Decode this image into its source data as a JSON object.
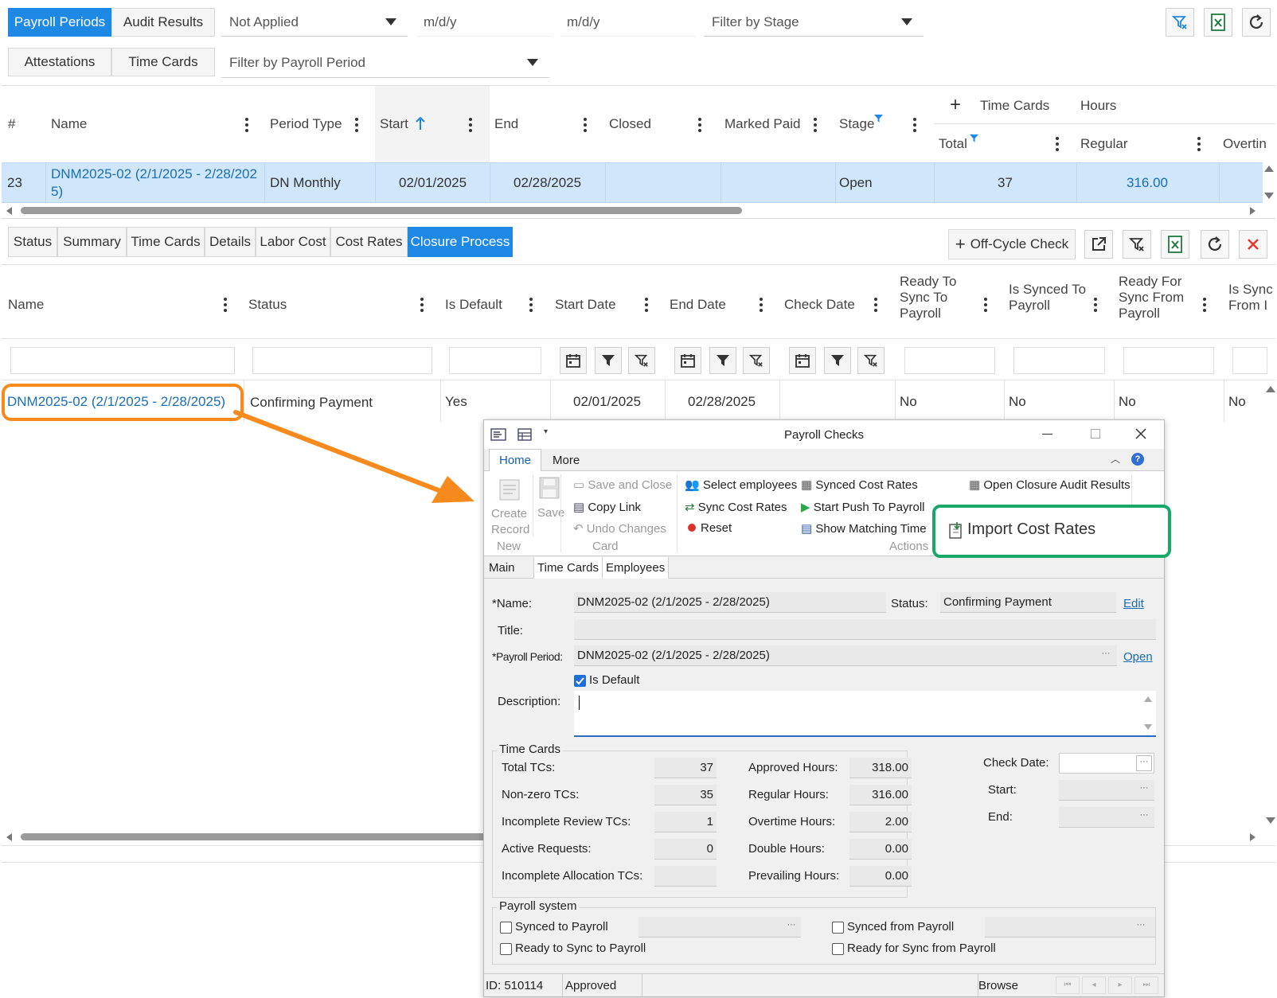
{
  "top_tabs": [
    "Payroll Periods",
    "Audit Results"
  ],
  "second_tabs": [
    "Attestations",
    "Time Cards"
  ],
  "filters": {
    "applied": "Not Applied",
    "date_from": "m/d/y",
    "date_to": "m/d/y",
    "stage_placeholder": "Filter by Stage",
    "period_placeholder": "Filter by Payroll Period"
  },
  "periods_grid": {
    "headers": {
      "num": "#",
      "name": "Name",
      "period_type": "Period Type",
      "start": "Start",
      "end": "End",
      "closed": "Closed",
      "marked_paid": "Marked Paid",
      "stage": "Stage",
      "time_cards": "Time Cards",
      "hours": "Hours",
      "total": "Total",
      "regular": "Regular",
      "overtime": "Overtin"
    },
    "row": {
      "num": "23",
      "name": "DNM2025-02 (2/1/2025 - 2/28/2025)",
      "name_l1": "DNM2025-02 (2/1/2025 - 2/28/202",
      "name_l2": "5)",
      "period_type": "DN Monthly",
      "start": "02/01/2025",
      "end": "02/28/2025",
      "closed": "",
      "marked_paid": "",
      "stage": "Open",
      "total": "37",
      "regular": "316.00"
    }
  },
  "detail_tabs": [
    "Status",
    "Summary",
    "Time Cards",
    "Details",
    "Labor Cost",
    "Cost Rates",
    "Closure Process"
  ],
  "off_cycle_label": "Off-Cycle Check",
  "closure_grid": {
    "headers": {
      "name": "Name",
      "status": "Status",
      "is_default": "Is Default",
      "start_date": "Start Date",
      "end_date": "End Date",
      "check_date": "Check Date",
      "ready_sync_to": [
        "Ready To",
        "Sync To",
        "Payroll"
      ],
      "is_synced_to": [
        "Is Synced To",
        "Payroll"
      ],
      "ready_sync_from": [
        "Ready For",
        "Sync From",
        "Payroll"
      ],
      "is_sync_from": [
        "Is Sync",
        "From I"
      ]
    },
    "row": {
      "name": "DNM2025-02 (2/1/2025 - 2/28/2025)",
      "status": "Confirming Payment",
      "is_default": "Yes",
      "start_date": "02/01/2025",
      "end_date": "02/28/2025",
      "check_date": "",
      "ready_sync_to": "No",
      "is_synced_to": "No",
      "ready_sync_from": "No",
      "is_sync_from": "No"
    }
  },
  "dialog": {
    "title": "Payroll Checks",
    "ribbon_tabs": [
      "Home",
      "More"
    ],
    "new_group": {
      "create": "Create",
      "record": "Record",
      "save": "Save",
      "label": "New"
    },
    "card_group": {
      "save_close": "Save and Close",
      "copy_link": "Copy Link",
      "undo": "Undo Changes",
      "label": "Card"
    },
    "actions": {
      "select_employees": "Select employees",
      "sync_cost_rates": "Sync Cost Rates",
      "reset": "Reset",
      "synced_cost_rates": "Synced Cost Rates",
      "start_push": "Start Push To Payroll",
      "show_matching": "Show Matching Time",
      "open_audit": "Open Closure Audit Results",
      "import_cost_rates": "Import Cost Rates",
      "label": "Actions"
    },
    "form_tabs": [
      "Main",
      "Time Cards",
      "Employees"
    ],
    "form": {
      "name_label": "*Name:",
      "name": "DNM2025-02 (2/1/2025 - 2/28/2025)",
      "status_label": "Status:",
      "status": "Confirming Payment",
      "edit": "Edit",
      "title_label": "Title:",
      "title": "",
      "period_label": "*Payroll Period:",
      "period": "DNM2025-02 (2/1/2025 - 2/28/2025)",
      "open": "Open",
      "is_default": "Is Default",
      "description_label": "Description:"
    },
    "time_cards": {
      "group": "Time Cards",
      "total_label": "Total TCs:",
      "total": "37",
      "nonzero_label": "Non-zero TCs:",
      "nonzero": "35",
      "incomplete_label": "Incomplete Review TCs:",
      "incomplete": "1",
      "active_label": "Active Requests:",
      "active": "0",
      "alloc_label": "Incomplete Allocation TCs:",
      "alloc": "",
      "approved_label": "Approved Hours:",
      "approved": "318.00",
      "regular_label": "Regular Hours:",
      "regular": "316.00",
      "overtime_label": "Overtime Hours:",
      "overtime": "2.00",
      "double_label": "Double Hours:",
      "double": "0.00",
      "prevailing_label": "Prevailing Hours:",
      "prevailing": "0.00",
      "check_date_label": "Check Date:",
      "start_label": "Start:",
      "end_label": "End:"
    },
    "payroll_system": {
      "group": "Payroll system",
      "synced_to": "Synced to Payroll",
      "ready_to": "Ready to Sync to Payroll",
      "synced_from": "Synced from Payroll",
      "ready_from": "Ready for Sync from Payroll"
    },
    "status_bar": {
      "id": "ID: 510114",
      "state": "Approved",
      "mode": "Browse"
    }
  },
  "colors": {
    "accent": "#1e88e5",
    "selected_row": "#cfe6fb",
    "callout_orange": "#f78a1d",
    "callout_green": "#1aa86a"
  }
}
